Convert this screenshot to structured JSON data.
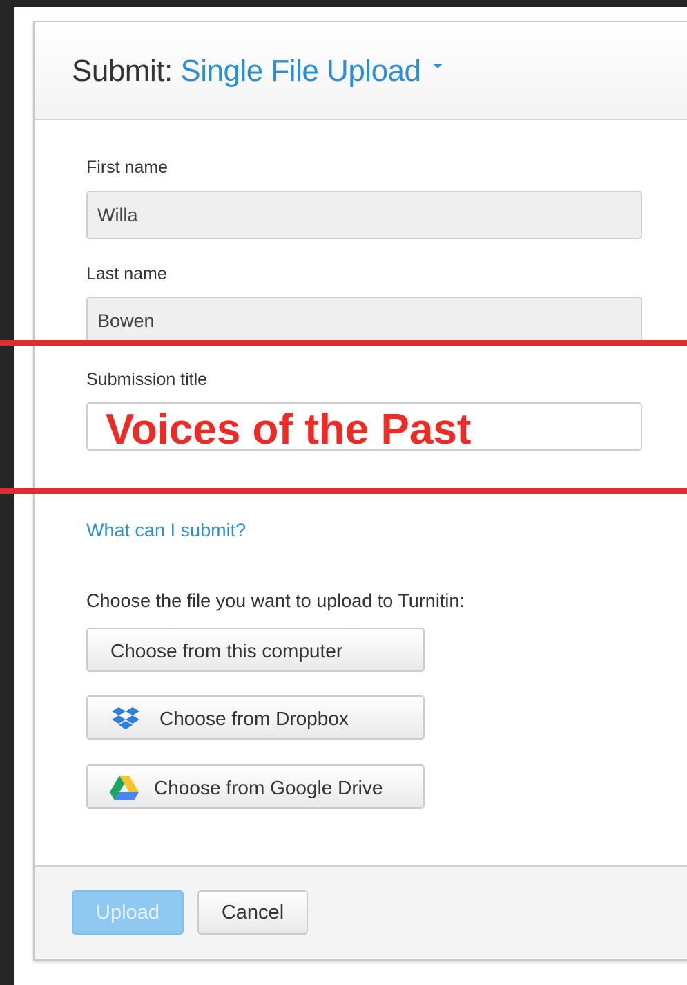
{
  "header": {
    "title_prefix": "Submit: ",
    "title_mode": "Single File Upload"
  },
  "form": {
    "first_name": {
      "label": "First name",
      "value": "Willa"
    },
    "last_name": {
      "label": "Last name",
      "value": "Bowen"
    },
    "submission_title": {
      "label": "Submission title",
      "value": "Voices of the Past"
    }
  },
  "help_link": "What can I submit?",
  "upload_prompt": "Choose the file you want to upload to Turnitin:",
  "sources": {
    "computer": "Choose from this computer",
    "dropbox": "Choose from Dropbox",
    "google_drive": "Choose from Google Drive"
  },
  "footer": {
    "upload": "Upload",
    "cancel": "Cancel"
  },
  "colors": {
    "accent": "#2c8fd6",
    "annotation": "#e12b2f",
    "upload_disabled": "#8fc9f2"
  },
  "icons": {
    "dropbox": "dropbox-icon",
    "google_drive": "google-drive-icon"
  }
}
